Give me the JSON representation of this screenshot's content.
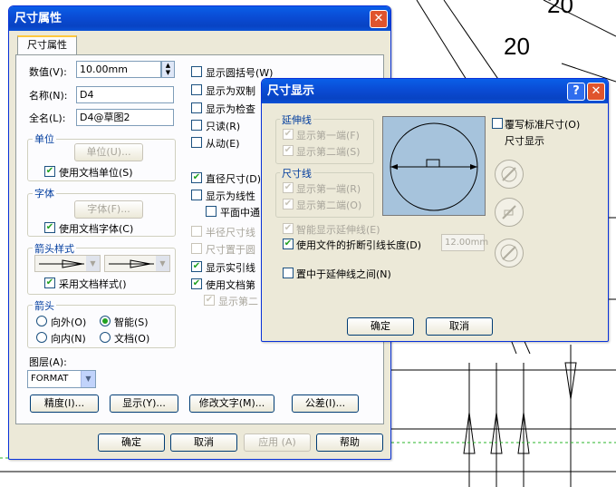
{
  "drawing": {
    "numbers": [
      "20",
      "20"
    ]
  },
  "dim_props": {
    "title": "尺寸属性",
    "close_glyph": "✕",
    "tab": "尺寸属性",
    "value_label": "数值(V):",
    "value": "10.00mm",
    "name_label": "名称(N):",
    "name": "D4",
    "fullname_label": "全名(L):",
    "fullname": "D4@草图2",
    "unit_group": "单位",
    "unit_button": "单位(U)...",
    "unit_use_doc": "使用文档单位(S)",
    "font_group": "字体",
    "font_button": "字体(F)...",
    "font_use_doc": "使用文档字体(C)",
    "arrow_style_group": "箭头样式",
    "arrow_use_doc": "采用文档样式()",
    "arrow_group": "箭头",
    "radio_outside": "向外(O)",
    "radio_smart": "智能(S)",
    "radio_inside": "向内(N)",
    "radio_doc": "文档(O)",
    "layer_label": "图层(A):",
    "layer_value": "FORMAT",
    "checks": [
      "显示圆括号(W)",
      "显示为双制",
      "显示为检查",
      "只读(R)",
      "从动(E)",
      "直径尺寸(D)",
      "显示为线性",
      "平面中通",
      "半径尺寸线",
      "尺寸置于圆",
      "显示实引线",
      "使用文档第",
      "显示第二"
    ],
    "btn_precision": "精度(I)...",
    "btn_display": "显示(Y)...",
    "btn_modify_text": "修改文字(M)...",
    "btn_tolerance": "公差(I)...",
    "btn_ok": "确定",
    "btn_cancel": "取消",
    "btn_apply": "应用 (A)",
    "btn_help": "帮助"
  },
  "dim_display": {
    "title": "尺寸显示",
    "help_glyph": "?",
    "close_glyph": "✕",
    "ext_group": "延伸线",
    "ext_first": "显示第一端(F)",
    "ext_second": "显示第二端(S)",
    "dim_group": "尺寸线",
    "dim_first": "显示第一端(R)",
    "dim_second": "显示第二端(O)",
    "smart_ext": "智能显示延伸线(E)",
    "use_doc_break": "使用文件的折断引线长度(D)",
    "break_value": "12.00mm",
    "center_between": "置中于延伸线之间(N)",
    "override_label": "覆写标准尺寸(O)",
    "dim_display_label": "尺寸显示",
    "btn_ok": "确定",
    "btn_cancel": "取消"
  },
  "colors": {
    "titlebar": "#0a4bd4",
    "face": "#ece9d8",
    "preview": "#a6c3dc",
    "accent": "#21a121"
  }
}
